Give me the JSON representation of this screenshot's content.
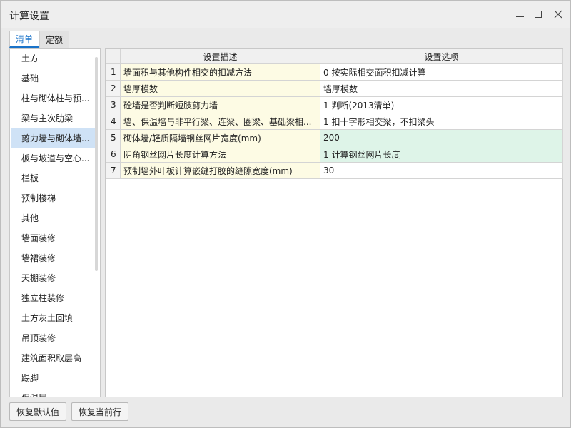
{
  "window": {
    "title": "计算设置"
  },
  "tabs": [
    {
      "label": "清单",
      "active": true
    },
    {
      "label": "定额",
      "active": false
    }
  ],
  "sidebar": {
    "items": [
      {
        "label": "土方"
      },
      {
        "label": "基础"
      },
      {
        "label": "柱与砌体柱与预..."
      },
      {
        "label": "梁与主次肋梁"
      },
      {
        "label": "剪力墙与砌体墙...",
        "selected": true
      },
      {
        "label": "板与坡道与空心..."
      },
      {
        "label": "栏板"
      },
      {
        "label": "预制楼梯"
      },
      {
        "label": "其他"
      },
      {
        "label": "墙面装修"
      },
      {
        "label": "墙裙装修"
      },
      {
        "label": "天棚装修"
      },
      {
        "label": "独立柱装修"
      },
      {
        "label": "土方灰土回填"
      },
      {
        "label": "吊顶装修"
      },
      {
        "label": "建筑面积取层高"
      },
      {
        "label": "踢脚"
      },
      {
        "label": "保温层"
      }
    ]
  },
  "grid": {
    "headers": {
      "num": "",
      "desc": "设置描述",
      "opt": "设置选项"
    },
    "rows": [
      {
        "num": "1",
        "desc": "墙面积与其他构件相交的扣减方法",
        "opt": "0 按实际相交面积扣减计算",
        "highlight": false
      },
      {
        "num": "2",
        "desc": "墙厚模数",
        "opt": "墙厚模数",
        "highlight": false
      },
      {
        "num": "3",
        "desc": "砼墙是否判断短肢剪力墙",
        "opt": "1 判断(2013清单)",
        "highlight": false
      },
      {
        "num": "4",
        "desc": "墙、保温墙与非平行梁、连梁、圈梁、基础梁相...",
        "opt": "1 扣十字形相交梁，不扣梁头",
        "highlight": false
      },
      {
        "num": "5",
        "desc": "砌体墙/轻质隔墙钢丝网片宽度(mm)",
        "opt": "200",
        "highlight": true
      },
      {
        "num": "6",
        "desc": "阴角钢丝网片长度计算方法",
        "opt": "1 计算钢丝网片长度",
        "highlight": true
      },
      {
        "num": "7",
        "desc": "预制墙外叶板计算嵌缝打胶的缝隙宽度(mm)",
        "opt": "30",
        "highlight": false
      }
    ]
  },
  "footer": {
    "restore_default": "恢复默认值",
    "restore_current": "恢复当前行"
  },
  "colors": {
    "accent": "#1a73c9",
    "selected_row": "#cfe2f6",
    "desc_bg": "#fdfbe4",
    "highlight_bg": "#def4e8"
  }
}
